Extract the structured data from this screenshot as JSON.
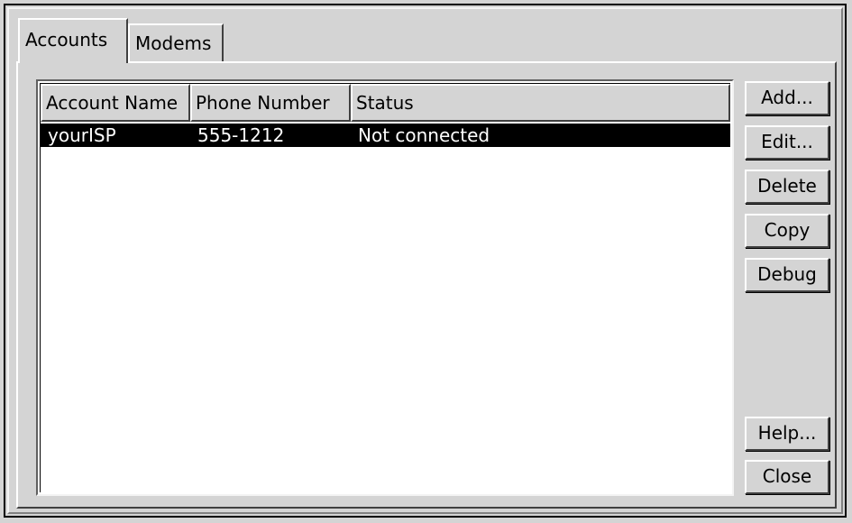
{
  "tabs": [
    {
      "label": "Accounts",
      "active": true
    },
    {
      "label": "Modems",
      "active": false
    }
  ],
  "table": {
    "columns": [
      "Account Name",
      "Phone Number",
      "Status"
    ],
    "rows": [
      {
        "account_name": "yourISP",
        "phone_number": "555-1212",
        "status": "Not connected",
        "selected": true
      }
    ]
  },
  "buttons": {
    "add": "Add...",
    "edit": "Edit...",
    "delete": "Delete",
    "copy": "Copy",
    "debug": "Debug",
    "help": "Help...",
    "close": "Close"
  },
  "colors": {
    "background": "#d4d4d4",
    "selection": "#000000",
    "selection_text": "#ffffff",
    "list_background": "#ffffff"
  }
}
